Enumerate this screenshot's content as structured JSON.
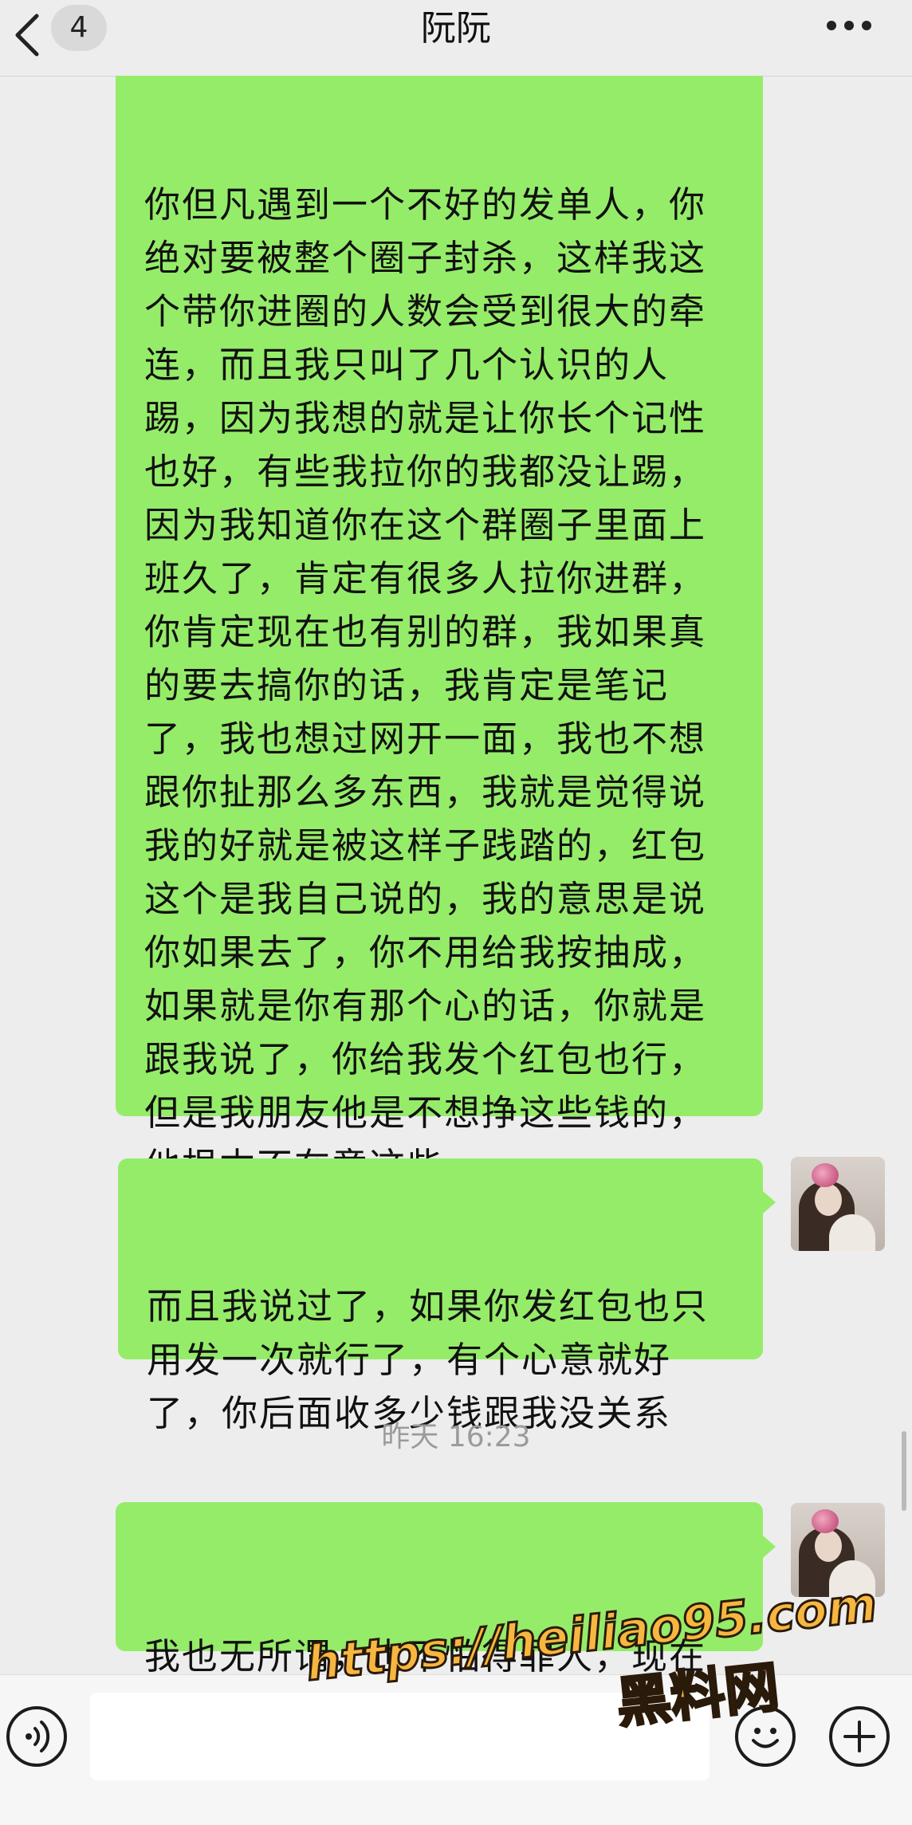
{
  "header": {
    "back_icon": "chevron-left-icon",
    "unread_count": "4",
    "title": "阮阮",
    "more_icon": "ellipsis-icon"
  },
  "messages": [
    {
      "sender": "self",
      "text": "你但凡遇到一个不好的发单人，你\n绝对要被整个圈子封杀，这样我这\n个带你进圈的人数会受到很大的牵\n连，而且我只叫了几个认识的人\n踢，因为我想的就是让你长个记性\n也好，有些我拉你的我都没让踢，\n因为我知道你在这个群圈子里面上\n班久了，肯定有很多人拉你进群，\n你肯定现在也有别的群，我如果真\n的要去搞你的话，我肯定是笔记\n了，我也想过网开一面，我也不想\n跟你扯那么多东西，我就是觉得说\n我的好就是被这样子践踏的，红包\n这个是我自己说的，我的意思是说\n你如果去了，你不用给我按抽成，\n如果就是你有那个心的话，你就是\n跟我说了，你给我发个红包也行，\n但是我朋友他是不想挣这些钱的，\n他根本不在意这些。"
    },
    {
      "sender": "self",
      "text": "而且我说过了，如果你发红包也只\n用发一次就行了，有个心意就好\n了，你后面收多少钱跟我没关系"
    },
    {
      "sender": "self",
      "text": "我也无所谓，也不怕得罪人，现在\n已经发单发到被搞疯了"
    }
  ],
  "timestamp": "昨天 16:23",
  "input_bar": {
    "voice_icon": "voice-icon",
    "input_value": "",
    "emoji_icon": "emoji-icon",
    "add_icon": "plus-icon"
  },
  "watermark": {
    "url": "https://heiliao95.com",
    "name": "黑料网"
  },
  "colors": {
    "background": "#ededed",
    "bubble": "#95ec69",
    "watermark_fill": "#f7b640",
    "watermark_stroke": "#2a1a0a",
    "timestamp_text": "#9b9b9b"
  }
}
